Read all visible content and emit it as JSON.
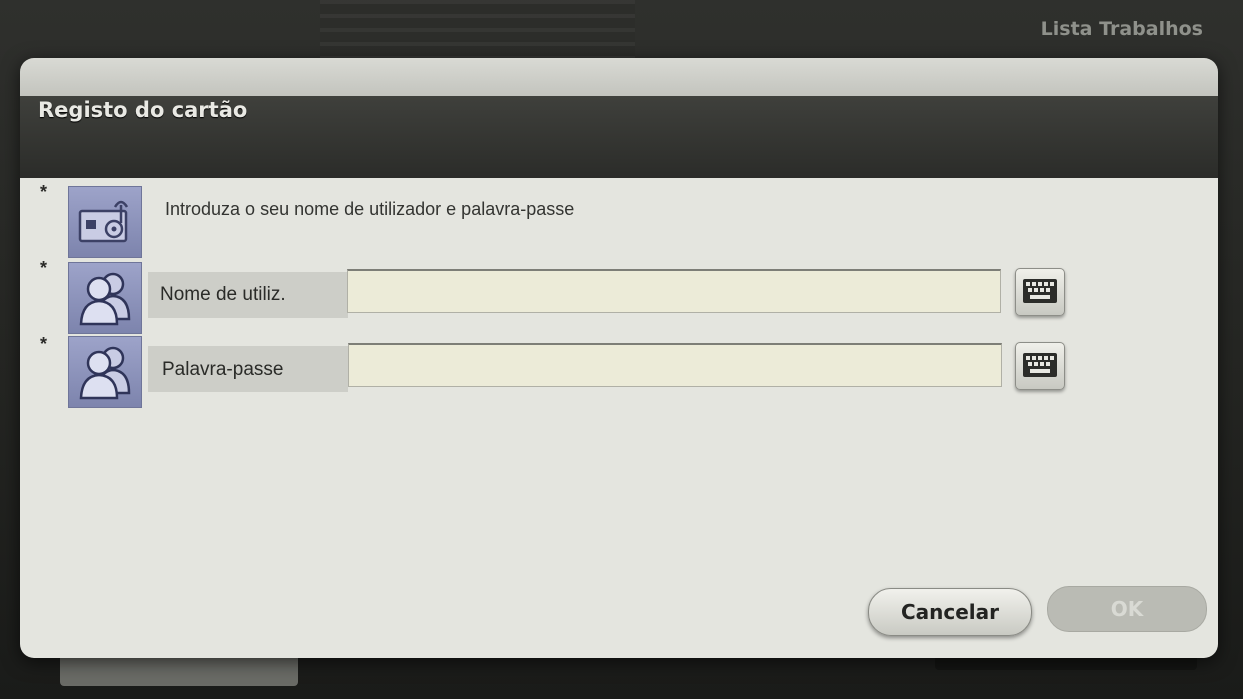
{
  "background": {
    "job_list_label": "Lista Trabalhos"
  },
  "dialog": {
    "title": "Registo do cartão",
    "required_marker": "*",
    "info": {
      "icon": "card-reader-icon",
      "text": "Introduza o seu nome de utilizador e palavra-passe"
    },
    "fields": [
      {
        "label": "Nome de utiliz.",
        "value": "",
        "icon": "users-icon",
        "keyboard_icon": "keyboard-icon"
      },
      {
        "label": "Palavra-passe",
        "value": "",
        "icon": "users-icon",
        "keyboard_icon": "keyboard-icon"
      }
    ],
    "buttons": {
      "cancel": "Cancelar",
      "ok": "OK",
      "ok_enabled": false
    }
  },
  "colors": {
    "title_bar": "#2b2c29",
    "body": "#e4e5df",
    "input_fill": "#ecebd8",
    "icon_blue": "#8d93bd"
  }
}
